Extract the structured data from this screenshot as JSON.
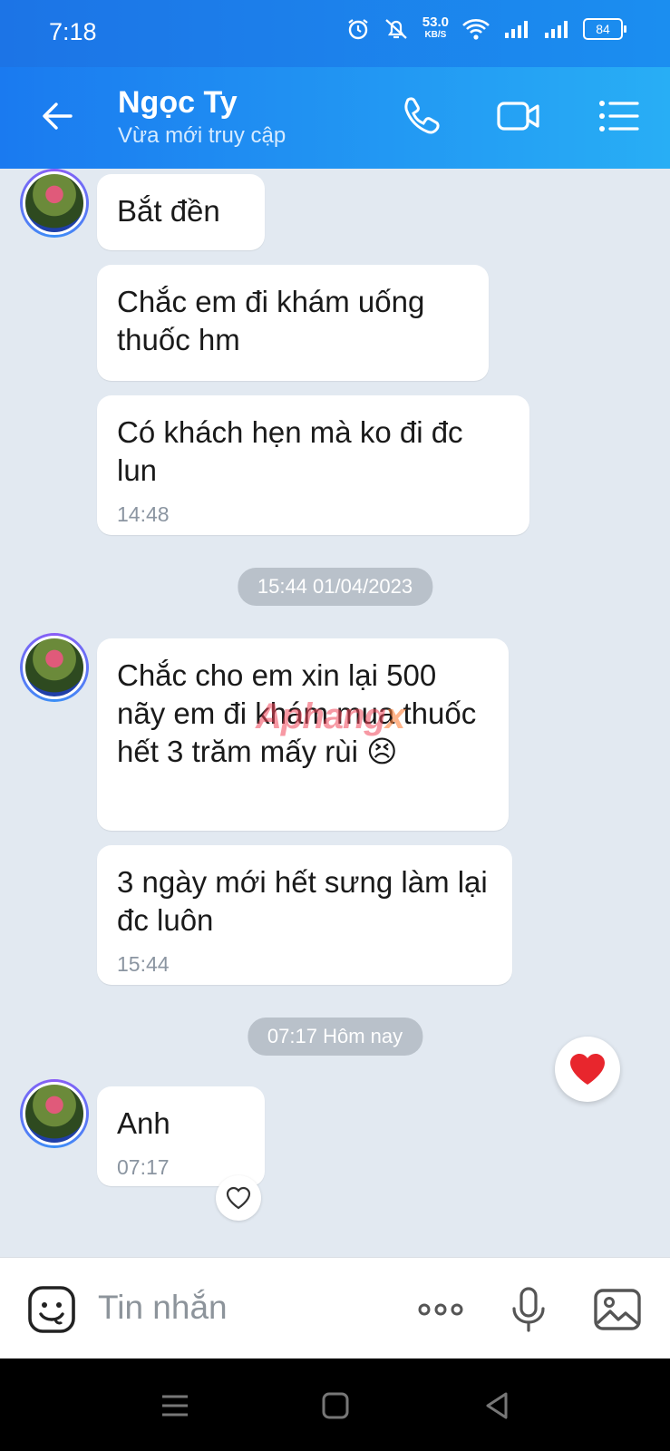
{
  "status_bar": {
    "time": "7:18",
    "net_speed_value": "53.0",
    "net_speed_unit": "KB/S",
    "battery": "84",
    "icons": [
      "alarm-icon",
      "mute-icon",
      "wifi-icon",
      "signal-icon",
      "signal-icon",
      "battery-icon"
    ]
  },
  "header": {
    "name": "Ngọc Ty",
    "status": "Vừa mới truy cập",
    "icons": [
      "back-arrow-icon",
      "phone-icon",
      "video-call-icon",
      "menu-list-icon"
    ],
    "accent": "#1a86f0"
  },
  "messages": [
    {
      "text": "Bắt đền"
    },
    {
      "text": "Chắc em đi khám uống thuốc hm"
    },
    {
      "text": "Có khách hẹn mà ko đi đc lun",
      "time": "14:48"
    },
    {
      "date_separator": "15:44 01/04/2023"
    },
    {
      "text": "Chắc cho em xin lại 500 nãy em đi khám mua thuốc hết 3 trăm mấy rùi 😣"
    },
    {
      "text": "3 ngày mới hết sưng làm lại đc luôn",
      "time": "15:44"
    },
    {
      "date_separator": "07:17 Hôm nay"
    },
    {
      "text": "Anh",
      "time": "07:17"
    }
  ],
  "watermark": {
    "part1": "Aphang",
    "part2": "x"
  },
  "input": {
    "placeholder": "Tin nhắn",
    "icons": [
      "emoji-sticker-icon",
      "more-icon",
      "microphone-icon",
      "image-icon"
    ]
  },
  "reactions": {
    "quick_heart": "heart-icon",
    "react_button": "heart-outline-icon",
    "heart_color": "#e8262d"
  },
  "nav": {
    "icons": [
      "recents-icon",
      "home-icon",
      "back-icon"
    ]
  }
}
